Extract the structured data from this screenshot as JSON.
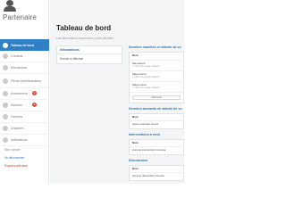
{
  "brand": {
    "name": "Partenaire"
  },
  "sidebar": {
    "items": [
      {
        "label": "Tableau de bord",
        "active": true,
        "badge": ""
      },
      {
        "label": "Contacts",
        "active": false,
        "badge": ""
      },
      {
        "label": "Discussions",
        "active": false,
        "badge": ""
      },
      {
        "label": "Pièces Administratives",
        "active": false,
        "badge": ""
      },
      {
        "label": "Avancement",
        "active": false,
        "badge": "1"
      },
      {
        "label": "Marchés",
        "active": false,
        "badge": "1"
      },
      {
        "label": "Factures",
        "active": false,
        "badge": ""
      },
      {
        "label": "Chantiers",
        "active": false,
        "badge": ""
      },
      {
        "label": "Notifications",
        "active": false,
        "badge": ""
      }
    ],
    "links": {
      "help": "Mon compte",
      "settings": "Se déconnecter",
      "danger": "Espace partenaire"
    }
  },
  "main": {
    "title": "Tableau de bord",
    "subtitle": "Les informations importantes y sont affichées",
    "info": {
      "heading": "Informations",
      "row": "Dernier à effectuer"
    },
    "markets": {
      "heading": "Derniers marchés en attente de vo",
      "row1": "Nom",
      "row2_name": "Menuiserie",
      "row2_detail": "» Nom du sous-traitant",
      "row3_name": "Maçonnerie",
      "row3_detail": "» Nom du sous-traitant",
      "row4_name": "Maçonnerie",
      "row4_detail": "» Nom du sous-traitant",
      "button": "Voir tout"
    },
    "avenants": {
      "heading": "Derniers avenants en attente de vo",
      "row1": "Nom",
      "row2": "Aucun avenant trouvé"
    },
    "interventions": {
      "heading": "Interventions à venir",
      "row1": "Nom",
      "row2": "Aucune intervention trouvée"
    },
    "discussions": {
      "heading": "Discussions",
      "row1": "Nom",
      "row2": "Aucune discussion trouvée"
    }
  }
}
